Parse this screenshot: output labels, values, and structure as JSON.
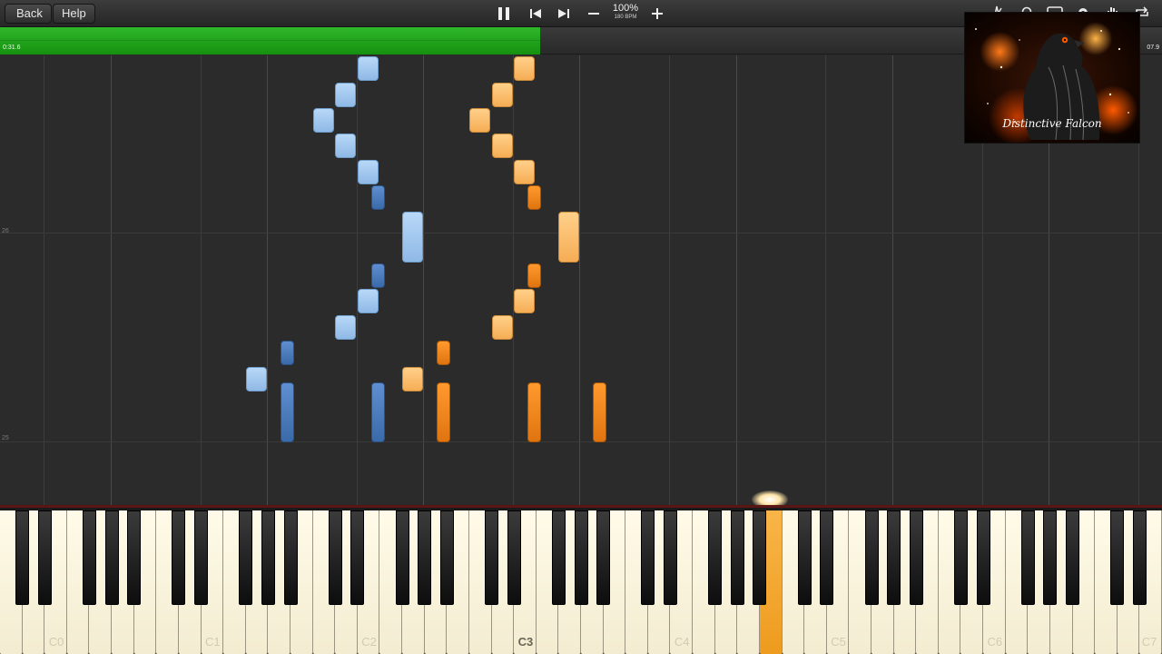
{
  "toolbar": {
    "back_label": "Back",
    "help_label": "Help",
    "speed_percent": "100%",
    "speed_bpm": "180 BPM"
  },
  "progress": {
    "elapsed": "0:31.6",
    "total": "07.9",
    "fraction": 0.465
  },
  "measures": [
    "26",
    "25"
  ],
  "album_art": {
    "caption": "Distinctive Falcon"
  },
  "keyboard": {
    "octave_labels": [
      "C0",
      "C1",
      "C2",
      "C3",
      "C4",
      "C5",
      "C6",
      "C7"
    ],
    "highlighted_label": "C3",
    "active_key_color": "#f0a030"
  },
  "colors": {
    "progress": "#1f9e1a",
    "left_hand_light": "#a6c8ee",
    "left_hand_dark": "#4a7cbf",
    "right_hand_light": "#f9be6a",
    "right_hand_dark": "#f08a1e"
  }
}
